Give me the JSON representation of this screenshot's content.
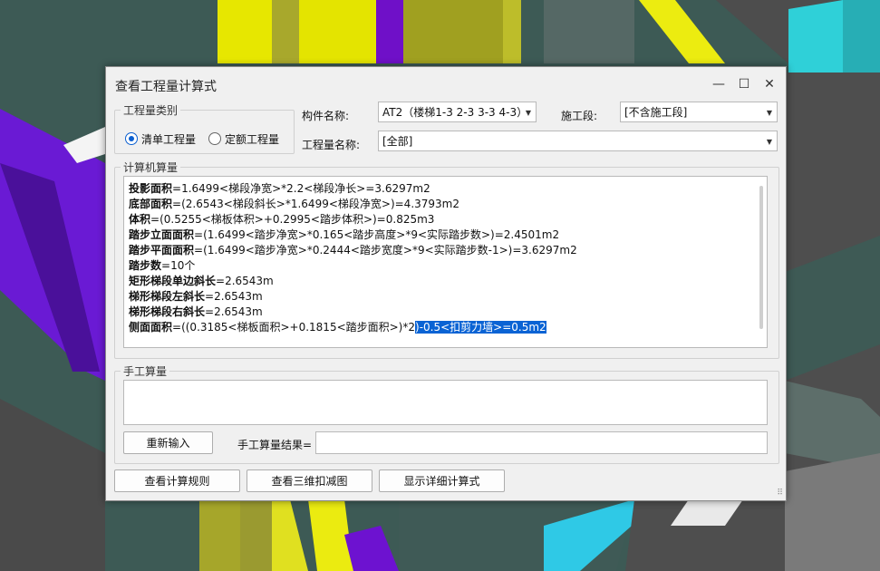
{
  "dialog": {
    "title": "查看工程量计算式",
    "minimize_label": "—",
    "maximize_label": "☐",
    "close_label": "✕"
  },
  "category": {
    "group_label": "工程量类别",
    "options": [
      {
        "label": "清单工程量",
        "selected": true
      },
      {
        "label": "定额工程量",
        "selected": false
      }
    ]
  },
  "component": {
    "label": "构件名称:",
    "value": "AT2（楼梯1-3 2-3 3-3 4-3）"
  },
  "construction_stage": {
    "label": "施工段:",
    "value": "[不含施工段]"
  },
  "quantity_name": {
    "label": "工程量名称:",
    "value": "[全部]"
  },
  "computer_calc": {
    "group_label": "计算机算量",
    "lines": [
      {
        "name": "投影面积",
        "expr": "=1.6499<梯段净宽>*2.2<梯段净长>=3.6297m2"
      },
      {
        "name": "底部面积",
        "expr": "=(2.6543<梯段斜长>*1.6499<梯段净宽>)=4.3793m2"
      },
      {
        "name": "体积",
        "expr": "=(0.5255<梯板体积>+0.2995<踏步体积>)=0.825m3"
      },
      {
        "name": "踏步立面面积",
        "expr": "=(1.6499<踏步净宽>*0.165<踏步高度>*9<实际踏步数>)=2.4501m2"
      },
      {
        "name": "踏步平面面积",
        "expr": "=(1.6499<踏步净宽>*0.2444<踏步宽度>*9<实际踏步数-1>)=3.6297m2"
      },
      {
        "name": "踏步数",
        "expr": "=10个"
      },
      {
        "name": "矩形梯段单边斜长",
        "expr": "=2.6543m"
      },
      {
        "name": "梯形梯段左斜长",
        "expr": "=2.6543m"
      },
      {
        "name": "梯形梯段右斜长",
        "expr": "=2.6543m"
      }
    ],
    "last_line": {
      "name": "侧面面积",
      "expr": "=((0.3185<梯板面积>+0.1815<踏步面积>)*2",
      "selected_expr": ")-0.5<扣剪力墙>=0.5m2"
    }
  },
  "manual_calc": {
    "group_label": "手工算量",
    "reenter_button": "重新输入",
    "result_label": "手工算量结果="
  },
  "footer": {
    "view_rules_button": "查看计算规则",
    "view_3d_button": "查看三维扣减图",
    "show_detail_button": "显示详细计算式"
  }
}
